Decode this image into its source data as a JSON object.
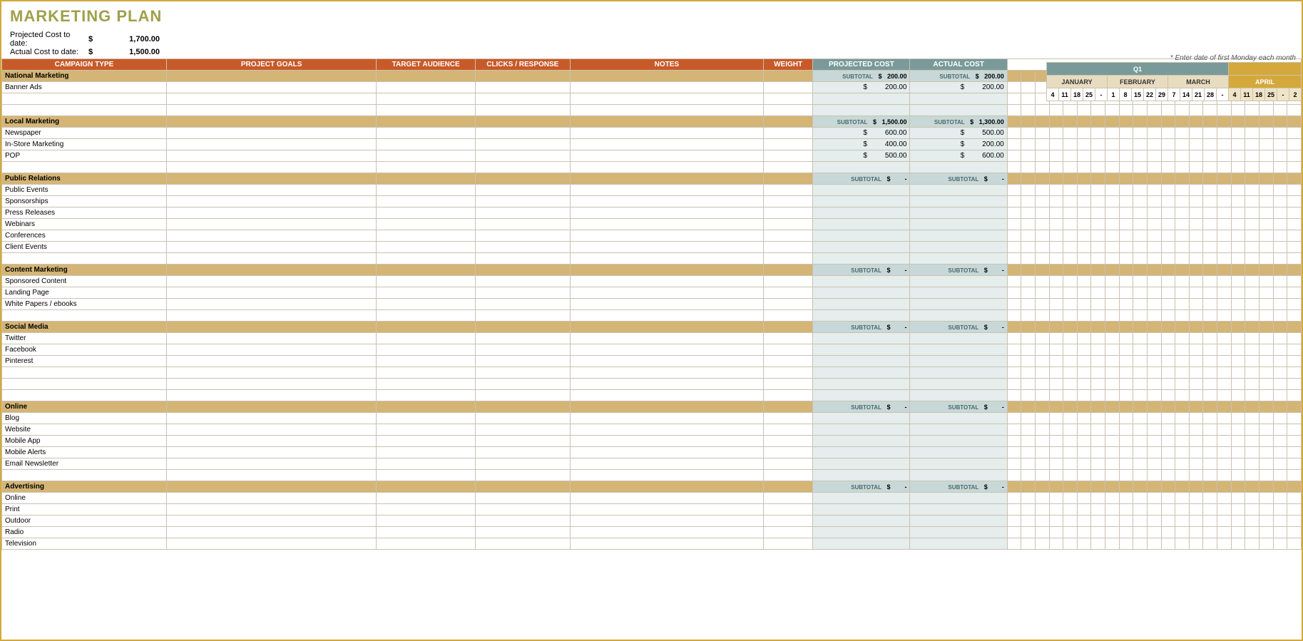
{
  "title": "MARKETING PLAN",
  "summary": {
    "projected_label": "Projected Cost to date:",
    "projected_sym": "$",
    "projected_val": "1,700.00",
    "actual_label": "Actual Cost to date:",
    "actual_sym": "$",
    "actual_val": "1,500.00"
  },
  "date_note": "* Enter date of first Monday each month",
  "quarter": "Q1",
  "months": [
    "JANUARY",
    "FEBRUARY",
    "MARCH",
    "APRIL"
  ],
  "days_jan": [
    "4",
    "11",
    "18",
    "25",
    "-"
  ],
  "days_feb": [
    "1",
    "8",
    "15",
    "22",
    "29"
  ],
  "days_mar": [
    "7",
    "14",
    "21",
    "28",
    "-"
  ],
  "days_apr": [
    "4",
    "11",
    "18",
    "25",
    "-",
    "2"
  ],
  "headers": {
    "campaign": "CAMPAIGN TYPE",
    "goals": "PROJECT GOALS",
    "target": "TARGET AUDIENCE",
    "clicks": "CLICKS / RESPONSE",
    "notes": "NOTES",
    "weight": "WEIGHT",
    "projected": "PROJECTED COST",
    "actual": "ACTUAL COST"
  },
  "subtotal_label": "SUBTOTAL",
  "dollar": "$",
  "dash": "-",
  "sections": [
    {
      "name": "National Marketing",
      "proj_sub": "200.00",
      "act_sub": "200.00",
      "rows": [
        {
          "name": "Banner Ads",
          "proj": "200.00",
          "act": "200.00"
        },
        {
          "name": ""
        },
        {
          "name": ""
        }
      ]
    },
    {
      "name": "Local Marketing",
      "proj_sub": "1,500.00",
      "act_sub": "1,300.00",
      "rows": [
        {
          "name": "Newspaper",
          "proj": "600.00",
          "act": "500.00"
        },
        {
          "name": "In-Store Marketing",
          "proj": "400.00",
          "act": "200.00"
        },
        {
          "name": "POP",
          "proj": "500.00",
          "act": "600.00"
        },
        {
          "name": ""
        }
      ]
    },
    {
      "name": "Public Relations",
      "proj_sub": "-",
      "act_sub": "-",
      "rows": [
        {
          "name": "Public Events"
        },
        {
          "name": "Sponsorships"
        },
        {
          "name": "Press Releases"
        },
        {
          "name": "Webinars"
        },
        {
          "name": "Conferences"
        },
        {
          "name": "Client Events"
        },
        {
          "name": ""
        }
      ]
    },
    {
      "name": "Content Marketing",
      "proj_sub": "-",
      "act_sub": "-",
      "rows": [
        {
          "name": "Sponsored Content"
        },
        {
          "name": "Landing Page"
        },
        {
          "name": "White Papers / ebooks"
        },
        {
          "name": ""
        }
      ]
    },
    {
      "name": "Social Media",
      "proj_sub": "-",
      "act_sub": "-",
      "rows": [
        {
          "name": "Twitter"
        },
        {
          "name": "Facebook"
        },
        {
          "name": "Pinterest"
        },
        {
          "name": ""
        },
        {
          "name": ""
        },
        {
          "name": ""
        }
      ]
    },
    {
      "name": "Online",
      "proj_sub": "-",
      "act_sub": "-",
      "rows": [
        {
          "name": "Blog"
        },
        {
          "name": "Website"
        },
        {
          "name": "Mobile App"
        },
        {
          "name": "Mobile Alerts"
        },
        {
          "name": "Email Newsletter"
        },
        {
          "name": ""
        }
      ]
    },
    {
      "name": "Advertising",
      "proj_sub": "-",
      "act_sub": "-",
      "rows": [
        {
          "name": "Online"
        },
        {
          "name": "Print"
        },
        {
          "name": "Outdoor"
        },
        {
          "name": "Radio"
        },
        {
          "name": "Television"
        }
      ]
    }
  ]
}
